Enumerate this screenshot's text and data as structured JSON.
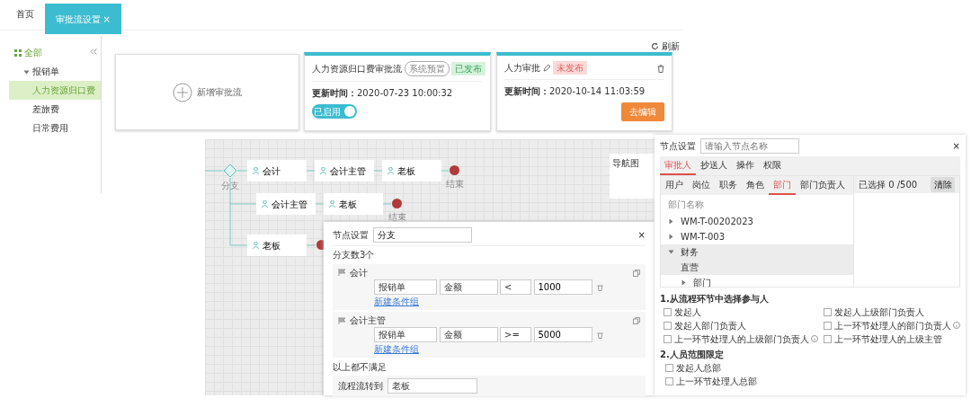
{
  "top_tabs": [
    {
      "label": "首页",
      "selected": false
    },
    {
      "label": "审批流设置",
      "selected": true,
      "close": "×"
    }
  ],
  "sidebar": {
    "items": [
      {
        "label": "全部",
        "selected": false,
        "children": [
          {
            "label": "报销单",
            "expanded": true,
            "selected": false,
            "children": [
              {
                "label": "人力资源归口费",
                "selected": true
              },
              {
                "label": "差旅费",
                "selected": false
              },
              {
                "label": "日常费用",
                "selected": false
              }
            ]
          }
        ]
      }
    ]
  },
  "refresh": "刷新",
  "new_card": {
    "label": "新增审批流"
  },
  "flow_cards": [
    {
      "title": "人力资源归口费审批流",
      "tag": "系统预置",
      "status": "已发布",
      "published": true,
      "editable": false,
      "deletable": false,
      "updated_label": "更新时间：",
      "updated": "2020-07-23 10:00:32",
      "toggle": {
        "label": "已启用",
        "on": true
      }
    },
    {
      "title": "人力审批",
      "status": "未发布",
      "published": false,
      "editable": true,
      "deletable": true,
      "updated_label": "更新时间：",
      "updated": "2020-10-14 11:03:59",
      "button": "去编辑"
    }
  ],
  "flow": {
    "gateway": "分支",
    "branches": [
      {
        "nodes": [
          "会计",
          "会计主管",
          "老板"
        ],
        "end": "结束"
      },
      {
        "nodes": [
          "会计主管",
          "老板"
        ],
        "end": "结束"
      },
      {
        "nodes": [
          "老板"
        ]
      }
    ],
    "minimap": "导航图"
  },
  "branch_dialog": {
    "title": "节点设置",
    "name": "分支",
    "count": "分支数3个",
    "close": "×",
    "branches": [
      {
        "title": "会计",
        "conditions": [
          {
            "form": "报销单",
            "field": "金额",
            "op": "<",
            "value": "1000"
          }
        ],
        "add_link": "新建条件组"
      },
      {
        "title": "会计主管",
        "conditions": [
          {
            "form": "报销单",
            "field": "金额",
            "op": ">=",
            "value": "5000"
          }
        ],
        "add_link": "新建条件组"
      }
    ],
    "otherwise": {
      "title": "以上都不满足",
      "label": "流程流转到",
      "value": "老板"
    }
  },
  "node_dialog": {
    "title": "节点设置",
    "placeholder": "请输入节点名称",
    "close": "×",
    "tabs": [
      {
        "label": "审批人",
        "selected": true
      },
      {
        "label": "抄送人",
        "selected": false
      },
      {
        "label": "操作",
        "selected": false
      },
      {
        "label": "权限",
        "selected": false
      }
    ],
    "subtabs": [
      {
        "label": "用户",
        "selected": false
      },
      {
        "label": "岗位",
        "selected": false
      },
      {
        "label": "职务",
        "selected": false
      },
      {
        "label": "角色",
        "selected": false
      },
      {
        "label": "部门",
        "selected": true
      },
      {
        "label": "部门负责人",
        "selected": false
      }
    ],
    "tree_header": "部门名称",
    "tree": [
      {
        "label": "WM-T-00202023",
        "expanded": false,
        "selected": false
      },
      {
        "label": "WM-T-003",
        "expanded": false,
        "selected": false
      },
      {
        "label": "财务",
        "expanded": true,
        "selected": true,
        "children": [
          {
            "label": "直营",
            "selected": true
          },
          {
            "label": "部门",
            "expanded": false,
            "selected": false
          }
        ]
      }
    ],
    "selected_count": "已选择 0 /500",
    "clear": "清除",
    "section1": "1.从流程环节中选择参与人",
    "options": [
      {
        "label": "发起人",
        "checked": false
      },
      {
        "label": "发起人上级部门负责人",
        "checked": false
      },
      {
        "label": "发起人部门负责人",
        "checked": false
      },
      {
        "label": "上一环节处理人的部门负责人",
        "checked": false,
        "info": true
      },
      {
        "label": "上一环节处理人的上级部门负责人",
        "checked": false,
        "info": true
      },
      {
        "label": "上一环节处理人的上级主管",
        "checked": false
      }
    ],
    "section2": "2.人员范围限定",
    "scope": [
      {
        "label": "发起人总部",
        "checked": false
      },
      {
        "label": "上一环节处理人总部",
        "checked": false
      }
    ]
  }
}
